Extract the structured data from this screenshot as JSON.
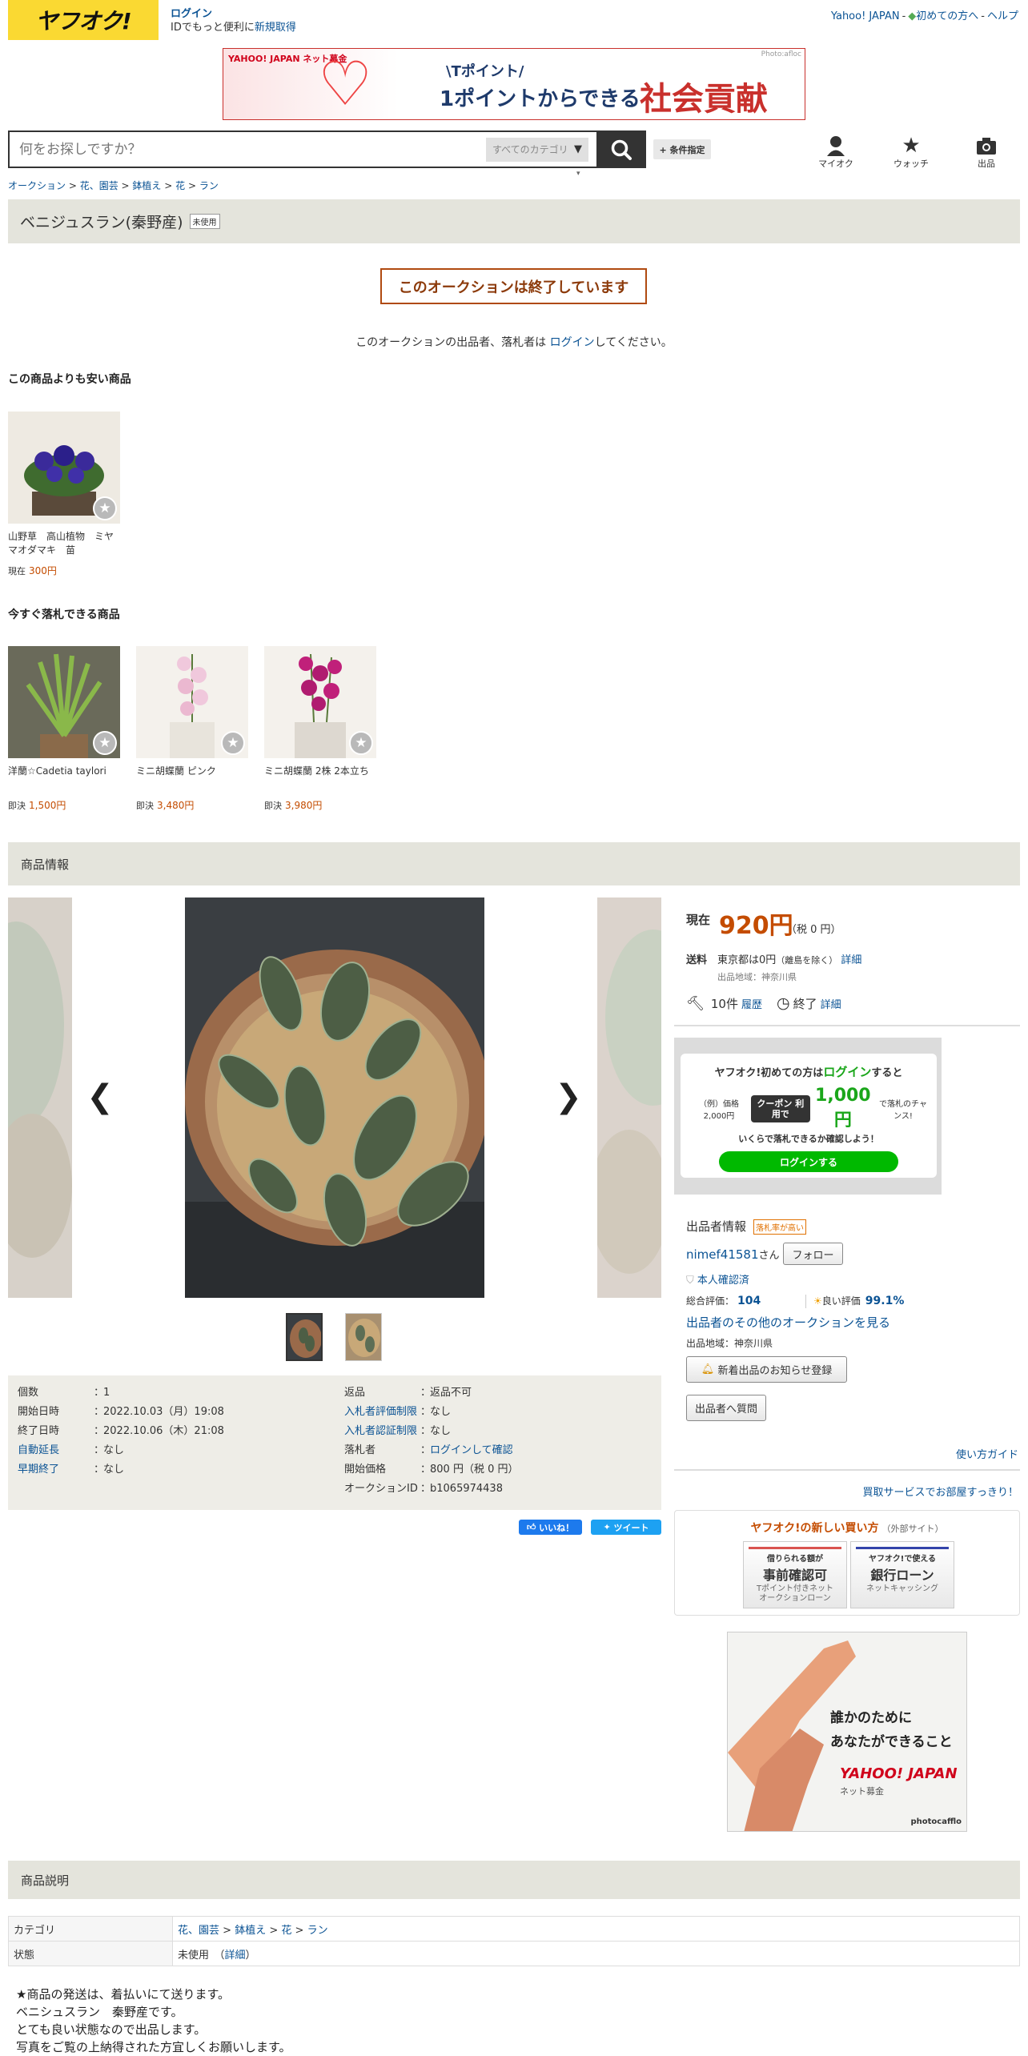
{
  "header": {
    "logo": "ヤフオク!",
    "login": "ログイン",
    "id_note": "IDでもっと便利に",
    "signup": "新規取得",
    "yahoo_japan": "Yahoo! JAPAN",
    "first_time": "初めての方へ",
    "help": "ヘルプ"
  },
  "banner": {
    "brand": "YAHOO! JAPAN ネット募金",
    "line1": "\\Tポイント/",
    "line2": "1ポイントからできる",
    "line3": "社会貢献",
    "credit": "Photo:afloc"
  },
  "search": {
    "placeholder": "何をお探しですか？",
    "category": "すべてのカテゴリ",
    "condition": "+ 条件指定"
  },
  "nav_icons": {
    "myauc": "マイオク",
    "watch": "ウォッチ",
    "sell": "出品"
  },
  "breadcrumb": [
    "オークション",
    "花、園芸",
    "鉢植え",
    "花",
    "ラン"
  ],
  "item": {
    "title": "ベニジュスラン(秦野産)",
    "condition_badge": "未使用",
    "ended": "このオークションは終了しています",
    "note_pre": "このオークションの出品者、落札者は",
    "note_link": "ログイン",
    "note_post": "してください。"
  },
  "cheaper": {
    "heading": "この商品よりも安い商品",
    "items": [
      {
        "name": "山野草　高山植物　ミヤマオダマキ　苗",
        "price_label": "現在",
        "price": "300円"
      }
    ]
  },
  "buynow": {
    "heading": "今すぐ落札できる商品",
    "items": [
      {
        "name": "洋蘭☆Cadetia taylori",
        "price_label": "即決",
        "price": "1,500円"
      },
      {
        "name": "ミニ胡蝶蘭 ピンク",
        "price_label": "即決",
        "price": "3,480円"
      },
      {
        "name": "ミニ胡蝶蘭 2株 2本立ち",
        "price_label": "即決",
        "price": "3,980円"
      }
    ]
  },
  "sections": {
    "info": "商品情報",
    "desc": "商品説明"
  },
  "details": {
    "left": [
      {
        "k": "個数",
        "v": "1",
        "link": false
      },
      {
        "k": "開始日時",
        "v": "2022.10.03（月）19:08",
        "link": false
      },
      {
        "k": "終了日時",
        "v": "2022.10.06（木）21:08",
        "link": false
      },
      {
        "k": "自動延長",
        "v": "なし",
        "link": true
      },
      {
        "k": "早期終了",
        "v": "なし",
        "link": true
      }
    ],
    "right": [
      {
        "k": "返品",
        "v": "返品不可",
        "link": false
      },
      {
        "k": "入札者評価制限",
        "v": "なし",
        "link": true
      },
      {
        "k": "入札者認証制限",
        "v": "なし",
        "link": true
      },
      {
        "k": "落札者",
        "v": "ログインして確認",
        "link": false
      },
      {
        "k": "開始価格",
        "v": "800 円（税 0 円）",
        "link": false
      },
      {
        "k": "オークションID",
        "v": "b1065974438",
        "link": false
      }
    ]
  },
  "share": {
    "like": "いいね！",
    "tweet": "ツイート"
  },
  "price": {
    "label": "現在",
    "value": "920円",
    "tax": "（税 0 円）",
    "ship_label": "送料",
    "ship_value": "東京都は0円",
    "ship_note": "（離島を除く）",
    "ship_detail": "詳細",
    "region": "出品地域：神奈川県",
    "bids": "10件",
    "history": "履歴",
    "end": "終了",
    "end_detail": "詳細"
  },
  "promo": {
    "line1_pre": "ヤフオク!初めての方は",
    "line1_link": "ログイン",
    "line1_post": "すると",
    "example": "（例）価格2,000円",
    "coupon": "クーポン 利用で",
    "amount": "1,000円",
    "chance": "で落札のチャンス!",
    "line3": "いくらで落札できるか確認しよう！",
    "button": "ログインする"
  },
  "seller": {
    "heading": "出品者情報",
    "badge": "落札率が高い",
    "name": "nimef41581",
    "san": "さん",
    "follow": "フォロー",
    "verified": "本人確認済",
    "rating_label": "総合評価：",
    "rating": "104",
    "good_label": "良い評価",
    "good": "99.1%",
    "other": "出品者のその他のオークションを見る",
    "region": "出品地域：神奈川県",
    "notify": "新着出品のお知らせ登録",
    "question": "出品者へ質問",
    "howto": "使い方ガイド",
    "buyout": "買取サービスでお部屋すっきり！"
  },
  "newbuy": {
    "heading": "ヤフオク!の新しい買い方",
    "external": "（外部サイト）",
    "card1": {
      "s1": "借りられる額が",
      "s2": "事前確認可",
      "s3": "Tポイント付きネット\nオークションローン"
    },
    "card2": {
      "s1": "ヤフオク!で使える",
      "s2": "銀行ローン",
      "s3": "ネットキャッシング"
    }
  },
  "ad": {
    "line1": "誰かのために",
    "line2": "あなたができること",
    "brand": "YAHOO! JAPAN",
    "sub": "ネット募金",
    "credit": "photocafflo"
  },
  "desc_table": [
    {
      "k": "カテゴリ",
      "v": [
        "花、園芸",
        "鉢植え",
        "花",
        "ラン"
      ]
    },
    {
      "k": "状態",
      "v_text": "未使用",
      "v_link": "詳細"
    }
  ],
  "description": [
    "★商品の発送は、着払いにて送ります。",
    "ベニシュスラン　秦野産です。",
    "とても良い状態なので出品します。",
    "写真をご覧の上納得された方宜しくお願いします。"
  ],
  "colors": {
    "brand": "#fad932",
    "price": "#c44c00",
    "link": "#0b5394",
    "promo_green": "#00b900"
  }
}
